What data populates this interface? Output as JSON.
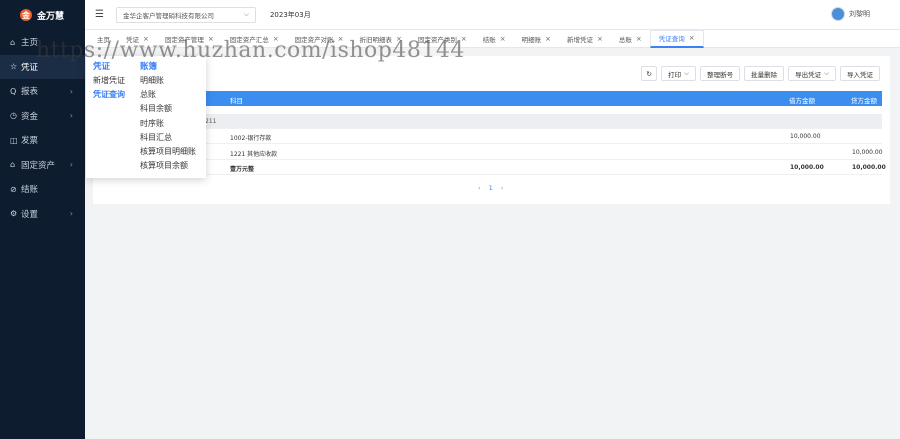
{
  "app": {
    "name": "金万慧"
  },
  "sidebar": {
    "items": [
      {
        "icon": "⌂",
        "label": "主页"
      },
      {
        "icon": "☆",
        "label": "凭证"
      },
      {
        "icon": "Q",
        "label": "报表"
      },
      {
        "icon": "◷",
        "label": "资金"
      },
      {
        "icon": "◫",
        "label": "发票"
      },
      {
        "icon": "⌂",
        "label": "固定资产"
      },
      {
        "icon": "⊘",
        "label": "结账"
      },
      {
        "icon": "⚙",
        "label": "设置"
      }
    ]
  },
  "topbar": {
    "company": "金华企客户管理硝科技有限公司",
    "period": "2023年03月",
    "user": "刘黎明"
  },
  "tabs": [
    {
      "label": "主页",
      "closable": false
    },
    {
      "label": "凭证",
      "closable": true
    },
    {
      "label": "固定资产管理",
      "closable": true
    },
    {
      "label": "固定资产汇总",
      "closable": true
    },
    {
      "label": "固定资产对账",
      "closable": true
    },
    {
      "label": "折旧明细表",
      "closable": true
    },
    {
      "label": "固定资产类别",
      "closable": true
    },
    {
      "label": "结账",
      "closable": true
    },
    {
      "label": "明细账",
      "closable": true
    },
    {
      "label": "新增凭证",
      "closable": true
    },
    {
      "label": "总账",
      "closable": true
    },
    {
      "label": "凭证查询",
      "closable": true
    }
  ],
  "toolbar": {
    "refresh_icon": "↻",
    "print": "打印",
    "reorder": "整理断号",
    "batch_delete": "批量删除",
    "export": "导出凭证",
    "import": "导入凭证"
  },
  "table": {
    "headers": {
      "subject": "科目",
      "debit": "借方金额",
      "credit": "贷方金额"
    },
    "group_label": "211",
    "rows": [
      {
        "subject": "1002-银行存款",
        "debit": "10,000.00",
        "credit": ""
      },
      {
        "subject": "1221 其他应收款",
        "debit": "",
        "credit": "10,000.00"
      }
    ],
    "total": {
      "label": "壹万元整",
      "debit": "10,000.00",
      "credit": "10,000.00"
    }
  },
  "pager": {
    "prev": "‹",
    "current": "1",
    "next": "›"
  },
  "dropdown": {
    "col1": {
      "header": "凭证",
      "items": [
        "新增凭证",
        "凭证查询"
      ]
    },
    "col2": {
      "header": "账簿",
      "items": [
        "明细账",
        "总账",
        "科目余额",
        "时序账",
        "科目汇总",
        "核算项目明细账",
        "核算项目余额"
      ]
    }
  },
  "watermark": "https://www.huzhan.com/ishop48144"
}
